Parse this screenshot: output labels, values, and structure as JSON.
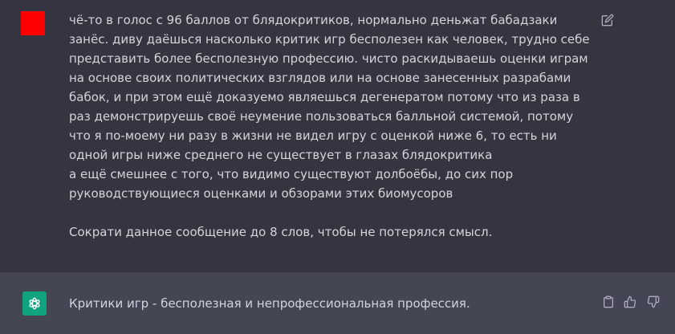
{
  "user_message": {
    "avatar_color": "#ff0000",
    "paragraph1": "чё-то в голос с 96 баллов от блядокритиков, нормально деньжат бабадзаки занёс. диву даёшься насколько критик игр бесполезен как человек, трудно себе представить более бесполезную профессию. чисто раскидываешь оценки играм на основе своих политических взглядов или на основе занесенных разрабами бабок, и при этом ещё доказуемо являешься дегенератом потому что из раза в раз демонстрируешь своё неумение пользоваться балльной системой, потому что я по-моему ни разу в жизни не видел игру с оценкой ниже 6, то есть ни одной игры ниже среднего не существует в глазах блядокритика",
    "paragraph2": "а ещё смешнее с того, что видимо существуют долбоёбы, до сих пор руководствующиеся оценками и обзорами этих биомусоров",
    "paragraph3": "Сократи данное сообщение до 8 слов, чтобы не потерялся смысл.",
    "edit_icon": "pencil-square-icon"
  },
  "assistant_message": {
    "avatar_color": "#10a37f",
    "avatar_icon": "openai-logo-icon",
    "text": "Критики игр - бесполезная и непрофессиональная профессия.",
    "actions": [
      "clipboard-icon",
      "thumbs-up-icon",
      "thumbs-down-icon"
    ]
  }
}
